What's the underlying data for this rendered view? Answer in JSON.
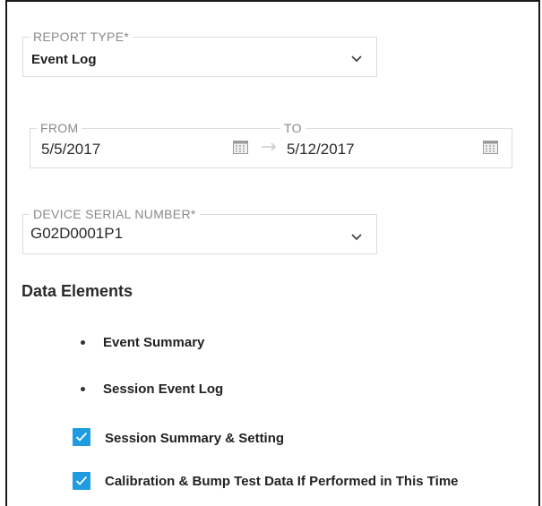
{
  "report_type": {
    "legend": "REPORT TYPE*",
    "value": "Event Log",
    "icon": "chevron-down-icon"
  },
  "date_range": {
    "from_legend": "FROM",
    "from_value": "5/5/2017",
    "to_legend": "TO",
    "to_value": "5/12/2017",
    "calendar_icon": "calendar-icon",
    "arrow_icon": "arrow-right-icon"
  },
  "device_serial": {
    "legend": "DEVICE SERIAL NUMBER*",
    "value": "G02D0001P1",
    "icon": "chevron-down-icon"
  },
  "data_elements": {
    "title": "Data Elements",
    "bullets": [
      "Event Summary",
      "Session Event Log"
    ],
    "checkboxes": [
      {
        "label": "Session Summary & Setting",
        "checked": true
      },
      {
        "label": "Calibration & Bump Test Data If Performed in This Time",
        "checked": true
      }
    ]
  },
  "colors": {
    "accent": "#1f9be0",
    "border": "#dcdcdc",
    "legend_text": "#8a8a8a"
  }
}
